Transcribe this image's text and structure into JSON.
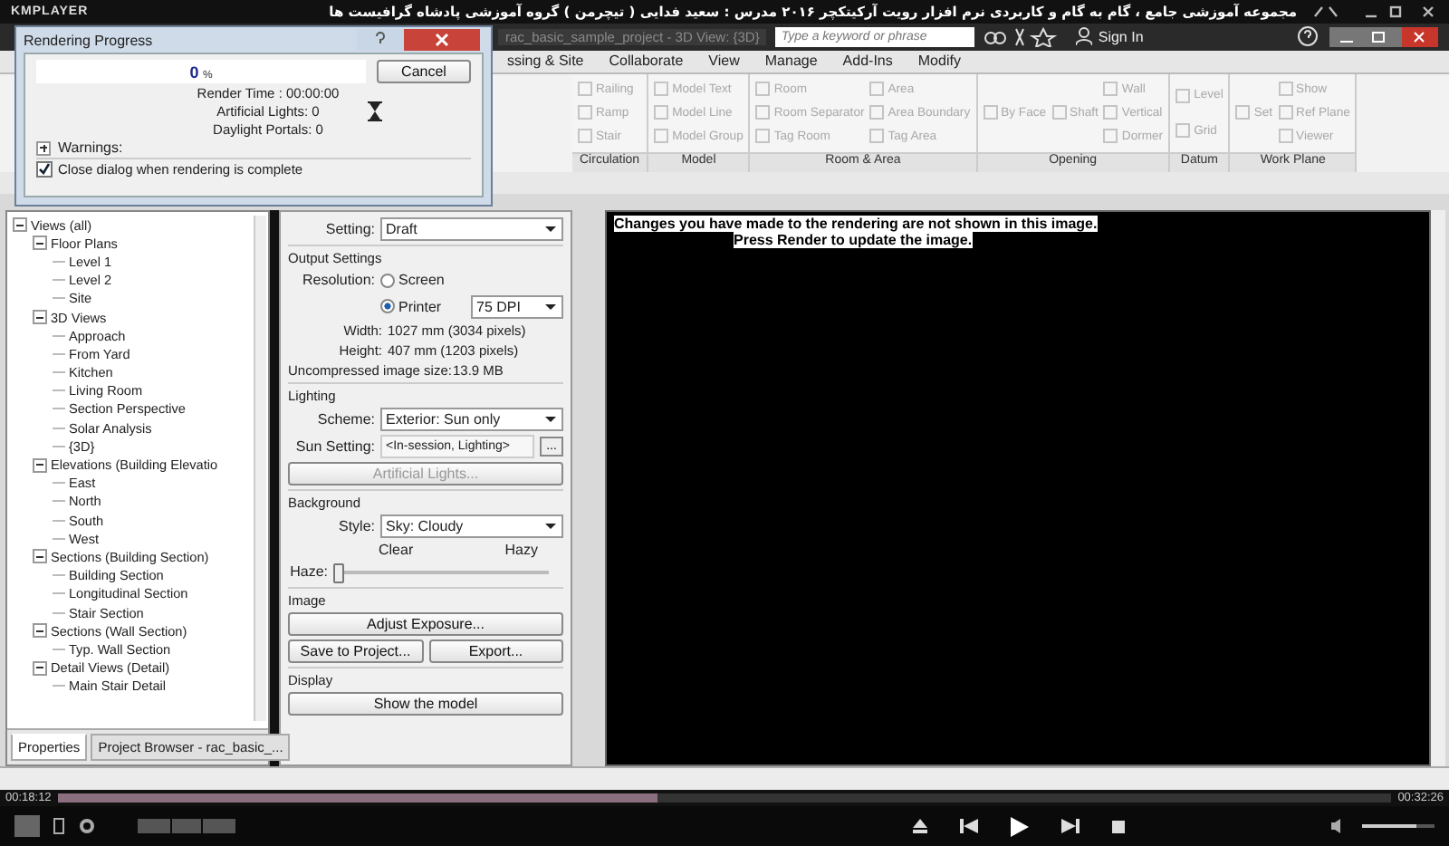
{
  "player": {
    "name": "KMPLAYER",
    "video_title": "مجموعه آموزشی جامع ، گام به گام و کاربردی نرم افزار رویت آرکیتکچر ۲۰۱۶  مدرس : سعید فدایی ( تیچرمن ) گروه آموزشی پادشاه گرافیست ها",
    "elapsed": "00:18:12",
    "total": "00:32:26",
    "level": 0.45,
    "volume": {
      "level": 0.75
    }
  },
  "app": {
    "document_title": "rac_basic_sample_project - 3D View: {3D}",
    "search": {
      "placeholder": "Type a keyword or phrase"
    },
    "sign_in": "Sign In"
  },
  "ribbon_tabs": [
    {
      "label": "ssing & Site"
    },
    {
      "label": "Collaborate"
    },
    {
      "label": "View"
    },
    {
      "label": "Manage"
    },
    {
      "label": "Add-Ins"
    },
    {
      "label": "Modify"
    }
  ],
  "ribbon_panels": [
    {
      "title": "Circulation",
      "columns": [
        [
          "Railing",
          "Ramp",
          "Stair"
        ]
      ]
    },
    {
      "title": "Model",
      "columns": [
        [
          "Model Text",
          "Model Line",
          "Model Group"
        ]
      ]
    },
    {
      "title": "Room & Area",
      "columns": [
        [
          "Room",
          "Room Separator",
          "Tag Room"
        ],
        [
          "Area",
          "Area Boundary",
          "Tag Area"
        ]
      ]
    },
    {
      "title": "Opening",
      "columns": [
        [
          "By Face"
        ],
        [
          "Shaft"
        ],
        [
          "Wall",
          "Vertical",
          "Dormer"
        ]
      ]
    },
    {
      "title": "Datum",
      "columns": [
        [
          "Level",
          "Grid"
        ]
      ]
    },
    {
      "title": "Work Plane",
      "columns": [
        [
          "Set"
        ],
        [
          "Show",
          "Ref Plane",
          "Viewer"
        ]
      ]
    }
  ],
  "dialog": {
    "title": "Rendering Progress",
    "progress": {
      "value": "0",
      "unit": "%",
      "level": 0
    },
    "cancel": "Cancel",
    "stats": [
      "Render Time : 00:00:00",
      "Artificial Lights: 0",
      "Daylight Portals: 0"
    ],
    "warnings": {
      "label": "Warnings:",
      "expanded": false
    },
    "close_option": {
      "label": "Close dialog when rendering is complete",
      "checked": true
    }
  },
  "project_browser": {
    "tree": [
      {
        "label": "Views (all)",
        "expanded": true,
        "children": [
          {
            "label": "Floor Plans",
            "expanded": true,
            "children": [
              {
                "label": "Level 1"
              },
              {
                "label": "Level 2"
              },
              {
                "label": "Site"
              }
            ]
          },
          {
            "label": "3D Views",
            "expanded": true,
            "children": [
              {
                "label": "Approach"
              },
              {
                "label": "From Yard"
              },
              {
                "label": "Kitchen"
              },
              {
                "label": "Living Room"
              },
              {
                "label": "Section Perspective"
              },
              {
                "label": "Solar Analysis"
              },
              {
                "label": "{3D}"
              }
            ]
          },
          {
            "label": "Elevations (Building Elevatio",
            "expanded": true,
            "children": [
              {
                "label": "East"
              },
              {
                "label": "North"
              },
              {
                "label": "South"
              },
              {
                "label": "West"
              }
            ]
          },
          {
            "label": "Sections (Building Section)",
            "expanded": true,
            "children": [
              {
                "label": "Building Section"
              },
              {
                "label": "Longitudinal Section"
              },
              {
                "label": "Stair Section"
              }
            ]
          },
          {
            "label": "Sections (Wall Section)",
            "expanded": true,
            "children": [
              {
                "label": "Typ. Wall Section"
              }
            ]
          },
          {
            "label": "Detail Views (Detail)",
            "expanded": true,
            "children": [
              {
                "label": "Main Stair Detail"
              }
            ]
          }
        ]
      }
    ],
    "tabs": [
      {
        "label": "Properties",
        "selected": true
      },
      {
        "label": "Project Browser - rac_basic_...",
        "selected": false
      }
    ]
  },
  "render_panel": {
    "setting": {
      "label": "Setting:",
      "value": "Draft"
    },
    "output": {
      "heading": "Output Settings",
      "resolution_label": "Resolution:",
      "options": [
        {
          "label": "Screen",
          "selected": false
        },
        {
          "label": "Printer",
          "selected": true
        }
      ],
      "dpi": "75 DPI",
      "rows": [
        {
          "label": "Width:",
          "value": "1027 mm (3034 pixels)"
        },
        {
          "label": "Height:",
          "value": "407 mm (1203 pixels)"
        },
        {
          "label": "Uncompressed image size:",
          "value": "13.9 MB"
        }
      ]
    },
    "lighting": {
      "heading": "Lighting",
      "scheme_label": "Scheme:",
      "scheme": "Exterior: Sun only",
      "sun_label": "Sun Setting:",
      "sun": "<In-session, Lighting>",
      "browse": "...",
      "artificial": "Artificial Lights..."
    },
    "background": {
      "heading": "Background",
      "style_label": "Style:",
      "style": "Sky: Cloudy",
      "left": "Clear",
      "right": "Hazy",
      "haze_label": "Haze:",
      "level": 0
    },
    "image": {
      "heading": "Image",
      "adjust": "Adjust Exposure...",
      "save": "Save to Project...",
      "export": "Export..."
    },
    "display": {
      "heading": "Display",
      "button": "Show the model"
    }
  },
  "view": {
    "messages": [
      "Changes you have made to the rendering are not shown in this image.",
      "Press Render to update the image."
    ]
  }
}
